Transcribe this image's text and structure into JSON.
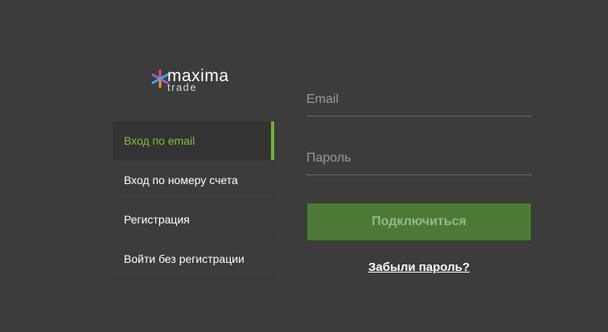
{
  "brand": {
    "name": "maxima",
    "sub": "trade",
    "colors": {
      "accent": "#6fb33c",
      "button": "#4c7a36",
      "background": "#3c3c3c"
    }
  },
  "nav": {
    "items": [
      {
        "label": "Вход по email",
        "active": true
      },
      {
        "label": "Вход по номеру счета",
        "active": false
      },
      {
        "label": "Регистрация",
        "active": false
      },
      {
        "label": "Войти без регистрации",
        "active": false
      }
    ]
  },
  "form": {
    "email_placeholder": "Email",
    "password_placeholder": "Пароль",
    "submit_label": "Подключиться",
    "forgot_label": "Забыли пароль?"
  }
}
